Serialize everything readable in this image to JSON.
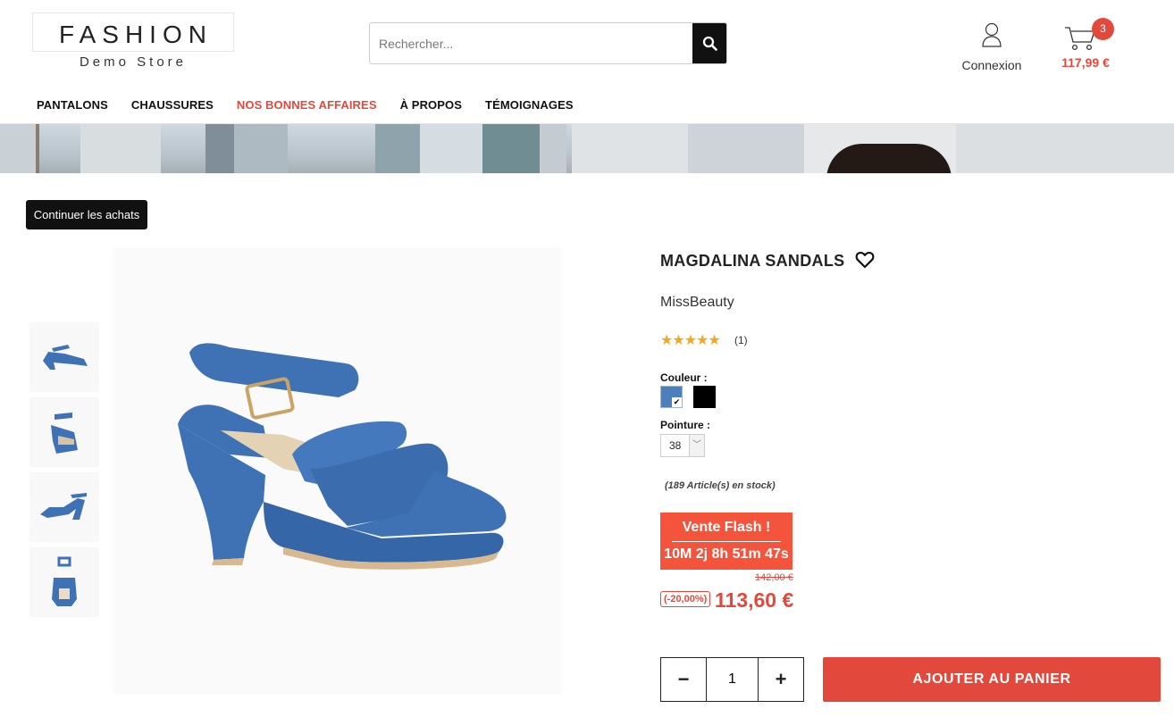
{
  "header": {
    "logo_main": "FASHION",
    "logo_sub": "Demo Store",
    "search_placeholder": "Rechercher...",
    "account_label": "Connexion",
    "cart_count": "3",
    "cart_total": "117,99 €"
  },
  "nav": {
    "items": [
      {
        "label": "PANTALONS"
      },
      {
        "label": "CHAUSSURES"
      },
      {
        "label": "NOS BONNES AFFAIRES"
      },
      {
        "label": "À PROPOS"
      },
      {
        "label": "TÉMOIGNAGES"
      }
    ]
  },
  "continue_label": "Continuer les achats",
  "product": {
    "title": "MAGDALINA SANDALS",
    "brand": "MissBeauty",
    "rating_stars": "★★★★★",
    "rating": 5,
    "review_count": "(1)",
    "color_label": "Couleur :",
    "colors": [
      {
        "name": "blue",
        "hex": "#4d7fbd",
        "selected": true
      },
      {
        "name": "black",
        "hex": "#000000",
        "selected": false
      }
    ],
    "size_label": "Pointure :",
    "size_value": "38",
    "stock": "(189 Article(s) en stock)",
    "flash_title": "Vente Flash !",
    "flash_timer": "10M 2j 8h 51m 47s",
    "old_price": "142,00 €",
    "discount": "(-20,00%)",
    "price": "113,60 €",
    "quantity": "1",
    "qty_minus": "−",
    "qty_plus": "+",
    "add_to_cart": "AJOUTER AU PANIER"
  },
  "colors": {
    "accent": "#e2493c",
    "flash_bg": "#f4543c",
    "dark": "#111111",
    "product_blue": "#3f72b5"
  }
}
